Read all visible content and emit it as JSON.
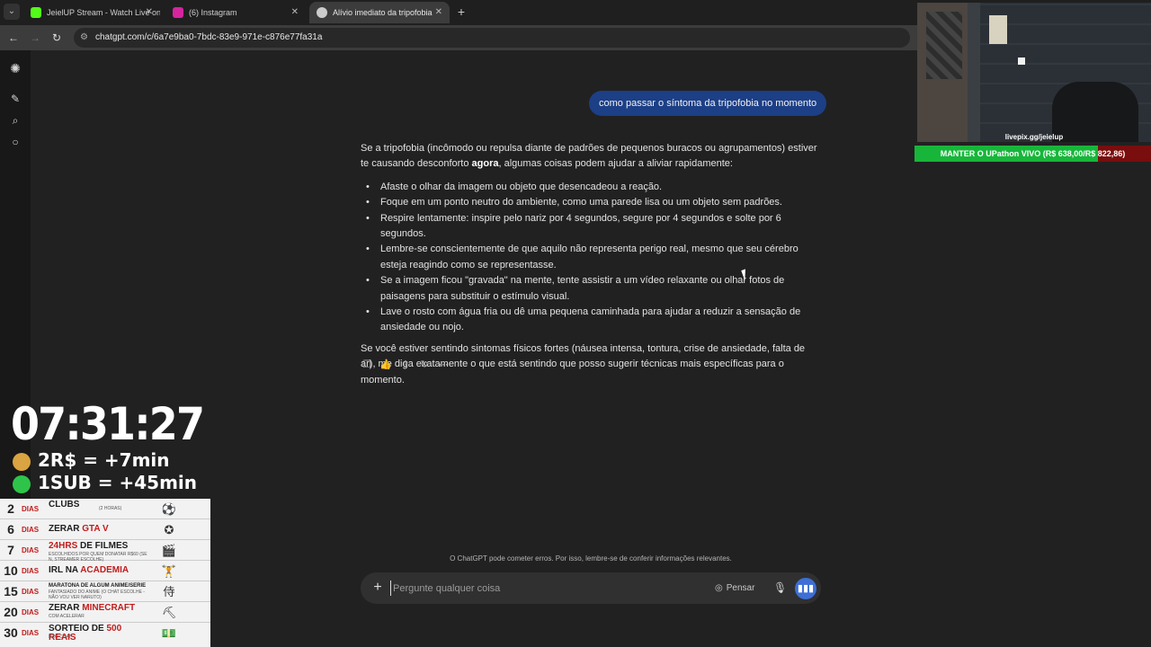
{
  "browser": {
    "tabs": [
      {
        "title": "JeielUP Stream - Watch Live on",
        "close": "✕",
        "favicon_color": "#53fc18",
        "active": false
      },
      {
        "title": "(6) Instagram",
        "close": "✕",
        "favicon_color": "#d6249f",
        "active": false
      },
      {
        "title": "Alívio imediato da tripofobia",
        "close": "✕",
        "favicon_color": "#cccccc",
        "active": true
      }
    ],
    "new_tab": "+",
    "url": "chatgpt.com/c/6a7e9ba0-7bdc-83e9-971e-c876e77fa31a"
  },
  "chat": {
    "user_message": "como passar o síntoma da tripofobia no momento",
    "answer": {
      "intro_before": "Se a tripofobia (incômodo ou repulsa diante de padrões de pequenos buracos ou agrupamentos) estiver te causando desconforto ",
      "intro_bold": "agora",
      "intro_after": ", algumas coisas podem ajudar a aliviar rapidamente:",
      "bullets": [
        "Afaste o olhar da imagem ou objeto que desencadeou a reação.",
        "Foque em um ponto neutro do ambiente, como uma parede lisa ou um objeto sem padrões.",
        "Respire lentamente: inspire pelo nariz por 4 segundos, segure por 4 segundos e solte por 6 segundos.",
        "Lembre-se conscientemente de que aquilo não representa perigo real, mesmo que seu cérebro esteja reagindo como se representasse.",
        "Se a imagem ficou \"gravada\" na mente, tente assistir a um vídeo relaxante ou olhar fotos de paisagens para substituir o estímulo visual.",
        "Lave o rosto com água fria ou dê uma pequena caminhada para ajudar a reduzir a sensação de ansiedade ou nojo."
      ],
      "closing": "Se você estiver sentindo sintomas físicos fortes (náusea intensa, tontura, crise de ansiedade, falta de ar), me diga exatamente o que está sentindo que posso sugerir técnicas mais específicas para o momento."
    },
    "action_icons": [
      "copy-icon",
      "thumbs-icon",
      "share-icon",
      "regenerate-icon",
      "more-icon"
    ],
    "disclaimer": "O ChatGPT pode cometer erros. Por isso, lembre-se de conferir informações relevantes.",
    "composer": {
      "placeholder": "Pergunte qualquer coisa",
      "think_label": "Pensar"
    }
  },
  "stream": {
    "webcam_label": "livepix.gg/jeielup",
    "goal_text": "MANTER O UPathon VIVO (R$ 638,00/R$ 822,86)",
    "goal_progress": 0.775,
    "timer": "07:31:27",
    "rate_money": "2R$ = +7min",
    "rate_sub": "1SUB = +45min",
    "goals": [
      {
        "num": "2",
        "dias": "DIAS",
        "title": "CLUBS",
        "hl": "",
        "sub": "(2 HORAS)",
        "icon": "soccer-ball-icon"
      },
      {
        "num": "6",
        "dias": "DIAS",
        "title": "ZERAR ",
        "hl": "GTA V",
        "sub": "",
        "icon": "gta-logo-icon"
      },
      {
        "num": "7",
        "dias": "DIAS",
        "title": "24HRS ",
        "hl": "DE FILMES",
        "sub": "ESCOLHIDOS POR QUEM DONATAR R$60 (SE N, STREAMER ESCOLHE)",
        "icon": "film-icon"
      },
      {
        "num": "10",
        "dias": "DIAS",
        "title": "IRL NA ",
        "hl": "ACADEMIA",
        "sub": "",
        "icon": "dumbbell-icon"
      },
      {
        "num": "15",
        "dias": "DIAS",
        "title": "MARATONA DE ALGUM ANIME/SERIE",
        "hl": "",
        "sub": "FANTASIADO DO ANIME (O CHAT ESCOLHE - NÃO VOU VER NARUTO)",
        "icon": "samurai-icon"
      },
      {
        "num": "20",
        "dias": "DIAS",
        "title": "ZERAR ",
        "hl": "MINECRAFT",
        "sub": "COM ACELERAR",
        "icon": "minecraft-icon"
      },
      {
        "num": "30",
        "dias": "DIAS",
        "title": "SORTEIO DE ",
        "hl": "500 REAIS",
        "sub": "PRO CHAT",
        "icon": "money-icon"
      }
    ]
  }
}
